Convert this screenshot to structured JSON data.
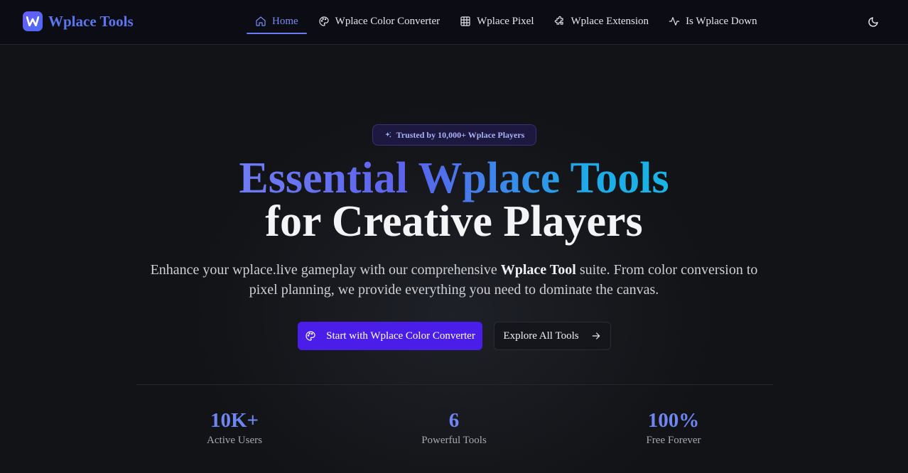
{
  "header": {
    "brand": "Wplace Tools",
    "nav": [
      {
        "label": "Home",
        "icon": "home-icon",
        "active": true
      },
      {
        "label": "Wplace Color Converter",
        "icon": "palette-icon",
        "active": false
      },
      {
        "label": "Wplace Pixel",
        "icon": "grid-icon",
        "active": false
      },
      {
        "label": "Wplace Extension",
        "icon": "puzzle-icon",
        "active": false
      },
      {
        "label": "Is Wplace Down",
        "icon": "activity-icon",
        "active": false
      }
    ],
    "theme_toggle_icon": "moon-icon"
  },
  "hero": {
    "badge": "Trusted by 10,000+ Wplace Players",
    "title_gradient": "Essential Wplace Tools",
    "title_plain": "for Creative Players",
    "lead_before": "Enhance your wplace.live gameplay with our comprehensive ",
    "lead_bold": "Wplace Tool",
    "lead_after": " suite. From color conversion to pixel planning, we provide everything you need to dominate the canvas.",
    "primary_button": "Start with Wplace Color Converter",
    "secondary_button": "Explore All Tools"
  },
  "stats": [
    {
      "value": "10K+",
      "label": "Active Users"
    },
    {
      "value": "6",
      "label": "Powerful Tools"
    },
    {
      "value": "100%",
      "label": "Free Forever"
    }
  ],
  "colors": {
    "accent": "#4b1de8",
    "brand": "#5b76f0",
    "stat": "#6f86f2",
    "background": "#121316"
  }
}
